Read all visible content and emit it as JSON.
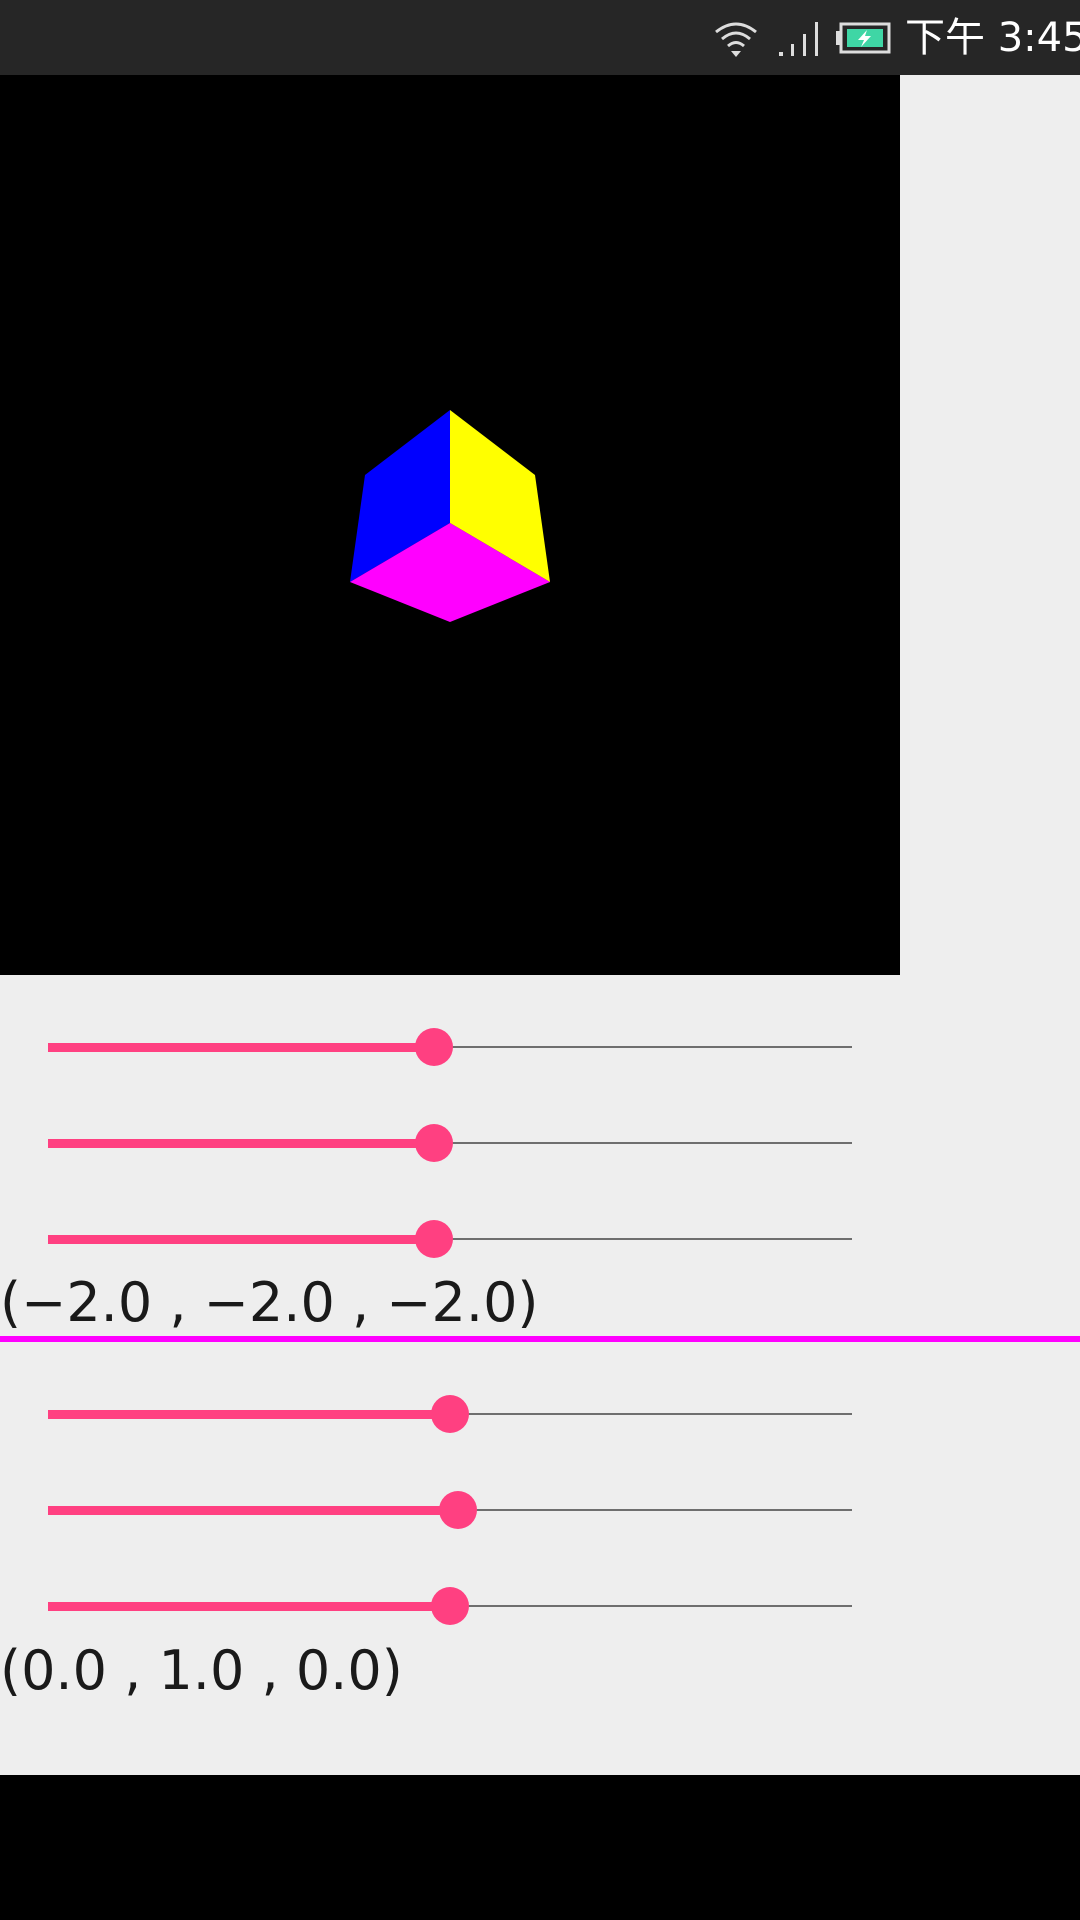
{
  "status_bar": {
    "time": "下午 3:45",
    "icons": [
      "wifi-icon",
      "signal-icon",
      "battery-charging-icon"
    ],
    "battery_color": "#3fd6a5"
  },
  "gl_view": {
    "background": "#000000",
    "cube_faces": {
      "left": "#0000ff",
      "right": "#ffff00",
      "bottom": "#ff00ff"
    }
  },
  "eye_sliders": [
    {
      "name": "eye-x",
      "progress": 0.48
    },
    {
      "name": "eye-y",
      "progress": 0.48
    },
    {
      "name": "eye-z",
      "progress": 0.48
    }
  ],
  "eye_label": "(−2.0 , −2.0 , −2.0)",
  "divider_color": "#ff00ff",
  "up_sliders": [
    {
      "name": "up-x",
      "progress": 0.5
    },
    {
      "name": "up-y",
      "progress": 0.51
    },
    {
      "name": "up-z",
      "progress": 0.5
    }
  ],
  "up_label": "(0.0 , 1.0 , 0.0)",
  "accent_color": "#ff4081"
}
